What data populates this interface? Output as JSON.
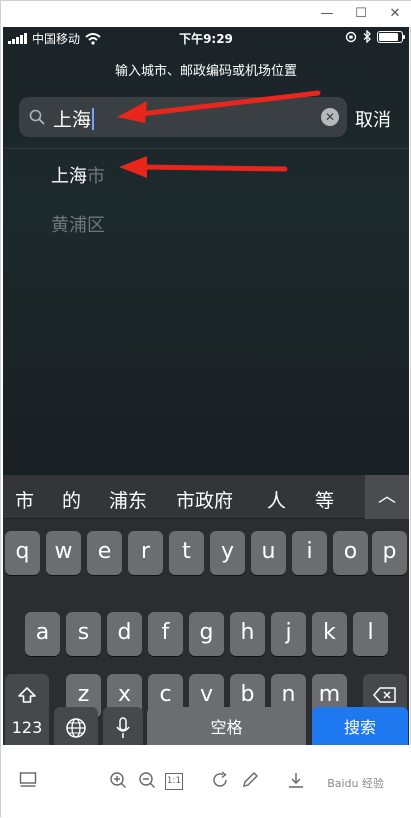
{
  "window": {
    "minimize": "—",
    "maximize": "☐",
    "close": "✕"
  },
  "statusbar": {
    "carrier": "中国移动",
    "time": "下午9:29"
  },
  "search": {
    "hint": "输入城市、邮政编码或机场位置",
    "value": "上海",
    "cancel_label": "取消"
  },
  "results": [
    {
      "typed": "上海",
      "suffix": "市"
    },
    {
      "label": "黄浦区"
    }
  ],
  "keyboard": {
    "candidates": [
      "市",
      "的",
      "浦东",
      "市政府",
      "人",
      "等"
    ],
    "toggle": "︿",
    "row1": [
      "q",
      "w",
      "e",
      "r",
      "t",
      "y",
      "u",
      "i",
      "o",
      "p"
    ],
    "row2": [
      "a",
      "s",
      "d",
      "f",
      "g",
      "h",
      "j",
      "k",
      "l"
    ],
    "row3": [
      "z",
      "x",
      "c",
      "v",
      "b",
      "n",
      "m"
    ],
    "num_label": "123",
    "space_label": "空格",
    "search_label": "搜索"
  },
  "toolbar": {
    "zoom_reset": "1:1",
    "watermark": "Baidu 经验"
  },
  "colors": {
    "accent": "#1e78f0",
    "arrow": "#e8261c",
    "background": "#1a2124"
  }
}
